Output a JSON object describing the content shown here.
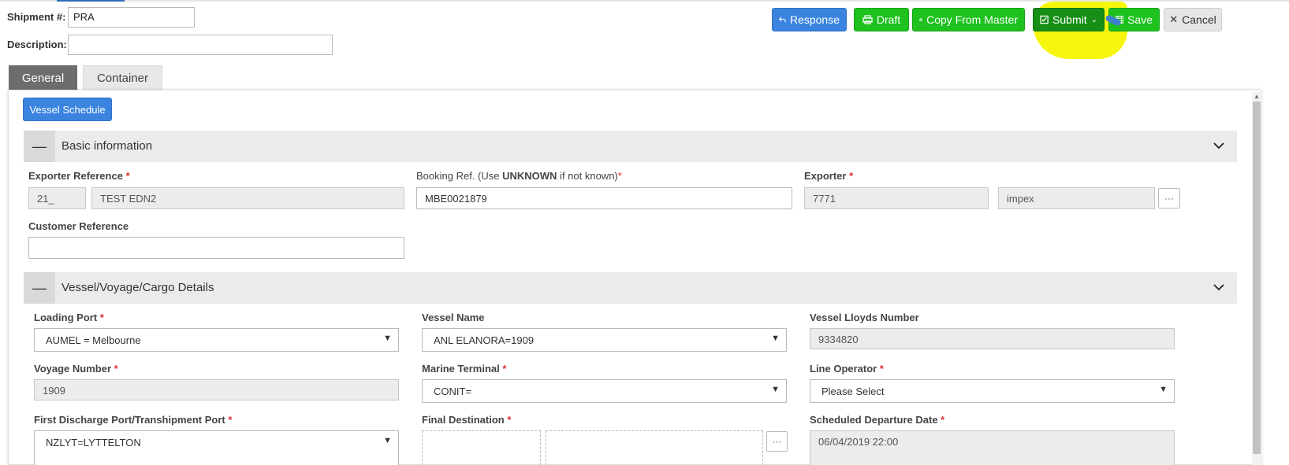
{
  "header": {
    "shipment_label": "Shipment #:",
    "shipment_value": "PRA",
    "description_label": "Description:",
    "description_value": ""
  },
  "toolbar": {
    "response": "Response",
    "draft": "Draft",
    "copy_from_master": "Copy From Master",
    "submit": "Submit",
    "save": "Save",
    "cancel": "Cancel"
  },
  "tabs": [
    {
      "label": "General",
      "active": true
    },
    {
      "label": "Container",
      "active": false
    }
  ],
  "vessel_schedule_button": "Vessel Schedule",
  "sections": {
    "basic": {
      "title": "Basic information",
      "exporter_reference_label": "Exporter Reference",
      "exporter_reference_prefix": "21_",
      "exporter_reference_value": "TEST EDN2",
      "booking_ref_label_pre": "Booking Ref. (Use ",
      "booking_ref_label_bold": "UNKNOWN",
      "booking_ref_label_post": " if not known)",
      "booking_ref_value": "MBE0021879",
      "exporter_label": "Exporter",
      "exporter_code": "7771",
      "exporter_name": "impex",
      "customer_reference_label": "Customer Reference",
      "customer_reference_value": ""
    },
    "vessel": {
      "title": "Vessel/Voyage/Cargo Details",
      "loading_port_label": "Loading Port",
      "loading_port_value": "AUMEL = Melbourne",
      "vessel_name_label": "Vessel Name",
      "vessel_name_value": "ANL ELANORA=1909",
      "lloyds_label": "Vessel Lloyds Number",
      "lloyds_value": "9334820",
      "voyage_label": "Voyage Number",
      "voyage_value": "1909",
      "terminal_label": "Marine Terminal",
      "terminal_value": "CONIT=",
      "line_operator_label": "Line Operator",
      "line_operator_value": "Please Select",
      "discharge_label": "First Discharge Port/Transhipment Port",
      "discharge_value": "NZLYT=LYTTELTON",
      "final_dest_label": "Final Destination",
      "departure_label": "Scheduled Departure Date",
      "departure_value": "06/04/2019 22:00"
    }
  },
  "colors": {
    "primary_blue": "#3a84df",
    "green": "#1ec11e",
    "required": "#d33333",
    "highlight": "#f5f500"
  }
}
